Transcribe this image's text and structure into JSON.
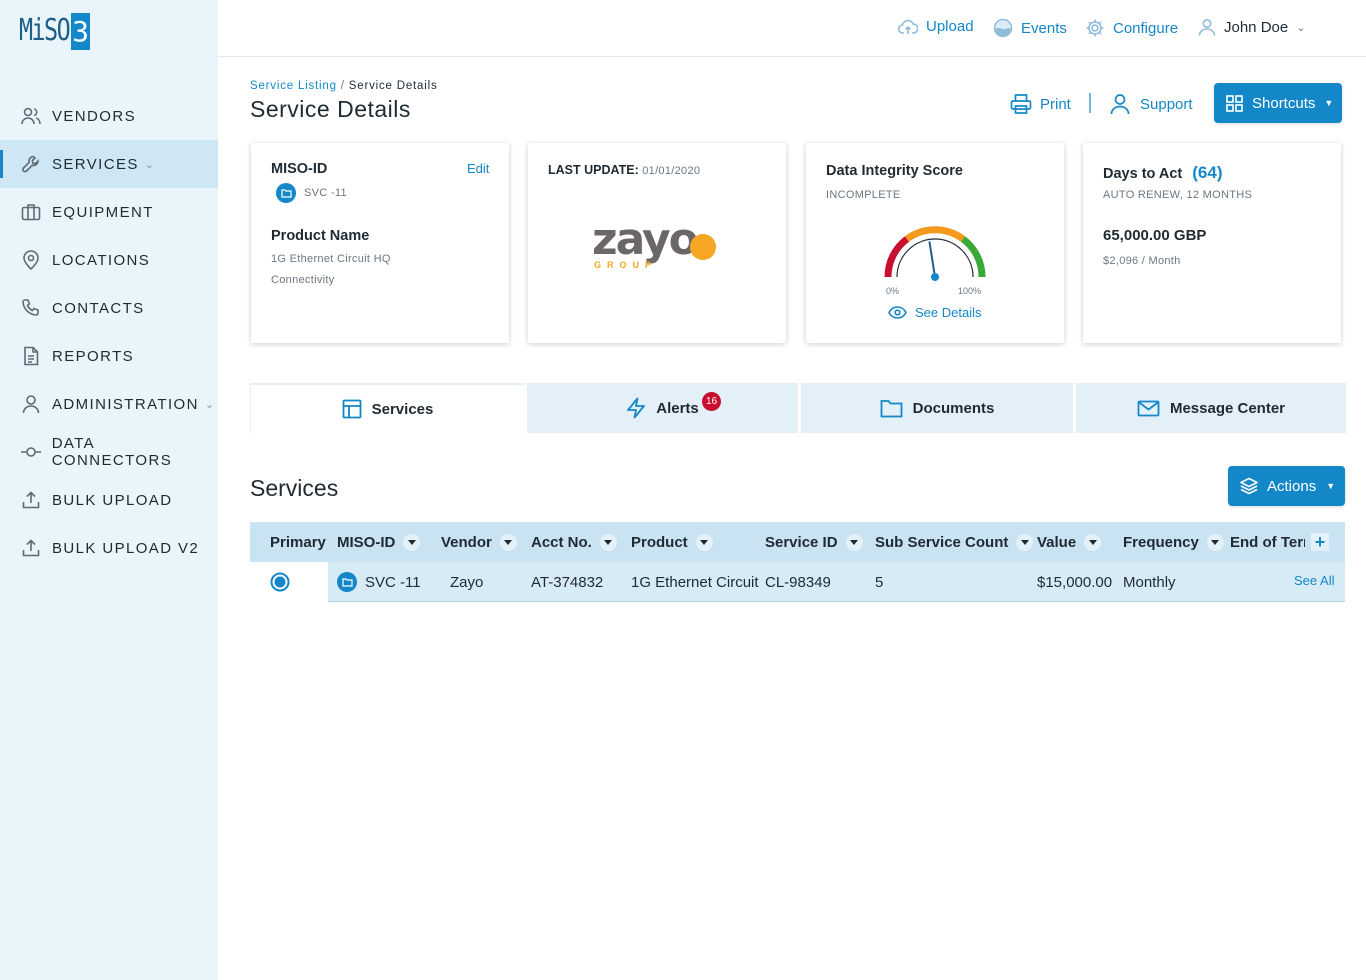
{
  "app": {
    "logo_text": "MiSO",
    "logo_number": "3"
  },
  "sidebar": {
    "items": [
      {
        "label": "VENDORS",
        "icon": "users-icon"
      },
      {
        "label": "SERVICES",
        "icon": "wrench-icon",
        "active": true,
        "caret": true
      },
      {
        "label": "EQUIPMENT",
        "icon": "briefcase-icon"
      },
      {
        "label": "LOCATIONS",
        "icon": "map-pin-icon"
      },
      {
        "label": "CONTACTS",
        "icon": "phone-icon"
      },
      {
        "label": "REPORTS",
        "icon": "document-icon"
      },
      {
        "label": "ADMINISTRATION",
        "icon": "user-icon",
        "caret": true
      },
      {
        "label": "DATA CONNECTORS",
        "icon": "connector-icon"
      },
      {
        "label": "BULK UPLOAD",
        "icon": "upload-icon"
      },
      {
        "label": "BULK UPLOAD V2",
        "icon": "upload-icon"
      }
    ]
  },
  "topbar": {
    "upload": "Upload",
    "events": "Events",
    "configure": "Configure",
    "user": "John Doe"
  },
  "breadcrumb": {
    "parent": "Service Listing",
    "separator": "/",
    "current": "Service Details"
  },
  "page_title": "Service Details",
  "header_actions": {
    "print": "Print",
    "support": "Support",
    "shortcuts": "Shortcuts"
  },
  "cards": {
    "miso": {
      "title": "MISO-ID",
      "edit": "Edit",
      "id": "SVC -11",
      "product_label": "Product Name",
      "product": "1G Ethernet Circuit HQ",
      "category": "Connectivity"
    },
    "update": {
      "title": "LAST UPDATE",
      "colon": ":",
      "date": "01/01/2020",
      "vendor_logo_main": "zayo",
      "vendor_logo_sub": "GROUP"
    },
    "integrity": {
      "title": "Data Integrity Score",
      "status": "INCOMPLETE",
      "min_label": "0%",
      "max_label": "100%",
      "link": "See Details",
      "score_fraction": 0.45
    },
    "act": {
      "title": "Days to Act",
      "days": "(64)",
      "renew": "AUTO RENEW, 12 MONTHS",
      "amount": "65,000.00 GBP",
      "monthly": "$2,096 / Month"
    }
  },
  "tabs": [
    {
      "label": "Services",
      "icon": "layout-icon",
      "active": true
    },
    {
      "label": "Alerts",
      "icon": "lightning-icon",
      "badge": "16"
    },
    {
      "label": "Documents",
      "icon": "folder-icon"
    },
    {
      "label": "Message Center",
      "icon": "mail-icon"
    }
  ],
  "services": {
    "title": "Services",
    "actions": "Actions",
    "columns": [
      "Primary",
      "MISO-ID",
      "Vendor",
      "Acct No.",
      "Product",
      "Service ID",
      "Sub Service Count",
      "Value",
      "Frequency",
      "End of Terr"
    ],
    "rows": [
      {
        "miso_id": "SVC -11",
        "vendor": "Zayo",
        "acct": "AT-374832",
        "product": "1G Ethernet Circuit",
        "service_id": "CL-98349",
        "sub_count": "5",
        "value": "$15,000.00",
        "frequency": "Monthly",
        "see_all": "See All"
      }
    ]
  },
  "colors": {
    "accent": "#1487c8",
    "sidebar": "#e9f4fb",
    "table_header": "#c9e3f3",
    "alert": "#c8102e"
  }
}
